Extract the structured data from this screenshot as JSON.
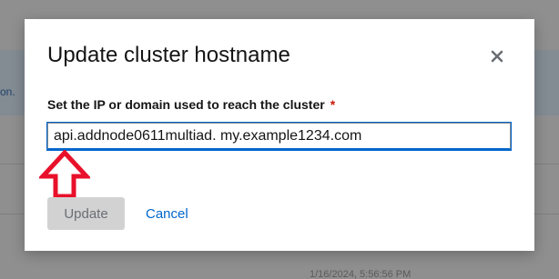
{
  "background": {
    "left_text": "on.",
    "bottom_left_text": "",
    "bottom_right_text": "1/16/2024, 5:56:56 PM"
  },
  "modal": {
    "title": "Update cluster hostname",
    "close_icon": "close-icon",
    "field": {
      "label": "Set the IP or domain used to reach the cluster",
      "required_marker": "*",
      "value": "api.addnode0611multiad. my.example1234.com"
    },
    "annotation_icon": "up-arrow-icon",
    "update_label": "Update",
    "cancel_label": "Cancel"
  },
  "colors": {
    "accent": "#0066cc",
    "required": "#c9190b",
    "annotation_arrow": "#e8102a",
    "disabled_button": "#d2d2d2"
  }
}
